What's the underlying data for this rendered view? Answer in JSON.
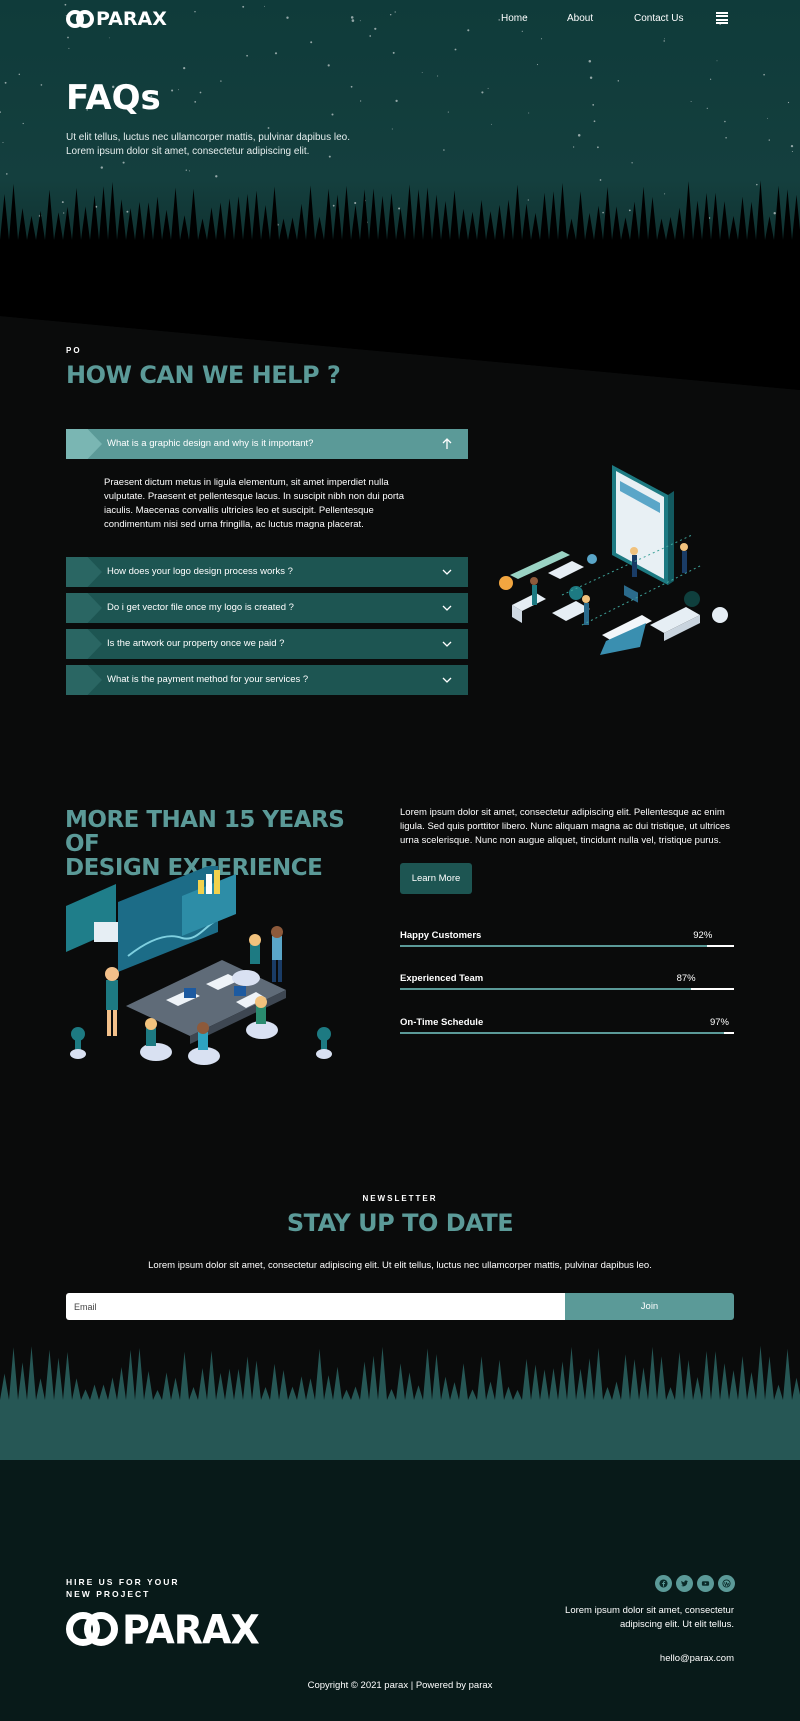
{
  "nav": {
    "logo_text": "PARAX",
    "links": [
      "Home",
      "About",
      "Contact Us"
    ]
  },
  "hero": {
    "title": "FAQs",
    "subtitle_line1": "Ut elit tellus, luctus nec ullamcorper mattis, pulvinar dapibus leo.",
    "subtitle_line2": "Lorem ipsum dolor sit amet, consectetur adipiscing elit."
  },
  "faq": {
    "eyebrow": "PO",
    "title": "HOW CAN WE HELP ?",
    "items": [
      {
        "question": "What is a graphic design and why is it important?",
        "expanded": true
      },
      {
        "question": "How does your logo design process works ?",
        "expanded": false
      },
      {
        "question": "Do i get vector file once my logo is created ?",
        "expanded": false
      },
      {
        "question": "Is the artwork our property once we paid ?",
        "expanded": false
      },
      {
        "question": "What is the payment method for your services ?",
        "expanded": false
      }
    ],
    "answer": "Praesent dictum metus in ligula elementum, sit amet imperdiet nulla vulputate. Praesent et pellentesque lacus. In suscipit nibh non dui porta iaculis. Maecenas convallis ultricies leo et suscipit. Pellentesque condimentum nisi sed urna fringilla, ac luctus magna placerat."
  },
  "experience": {
    "title_line1": "MORE THAN 15 YEARS OF",
    "title_line2": "DESIGN EXPERIENCE",
    "text": "Lorem ipsum dolor sit amet, consectetur adipiscing elit. Pellentesque ac enim ligula. Sed quis porttitor libero. Nunc aliquam magna ac dui tristique, ut ultrices urna scelerisque. Nunc non augue aliquet, tincidunt nulla vel, tristique purus.",
    "button_label": "Learn More",
    "skills": [
      {
        "name": "Happy Customers",
        "percent_label": "92%",
        "value": 92
      },
      {
        "name": "Experienced Team",
        "percent_label": "87%",
        "value": 87
      },
      {
        "name": "On-Time Schedule",
        "percent_label": "97%",
        "value": 97
      }
    ]
  },
  "newsletter": {
    "eyebrow": "NEWSLETTER",
    "title": "STAY UP TO DATE",
    "text": "Lorem ipsum dolor sit amet, consectetur adipiscing elit. Ut elit tellus, luctus nec ullamcorper mattis, pulvinar dapibus leo.",
    "email_placeholder": "Email",
    "join_label": "Join"
  },
  "footer": {
    "hire_line1": "HIRE US FOR YOUR",
    "hire_line2": "NEW PROJECT",
    "logo_text": "PARAX",
    "social_icons": [
      "facebook-icon",
      "twitter-icon",
      "youtube-icon",
      "wordpress-icon"
    ],
    "text": "Lorem ipsum dolor sit amet, consectetur adipiscing elit. Ut elit tellus.",
    "email": "hello@parax.com",
    "copyright": "Copyright © 2021 parax | Powered by parax"
  },
  "colors": {
    "accent": "#5b9a98",
    "dark_teal": "#1d5552",
    "hero_bg": "#0f3b3a",
    "page_bg": "#0a0b0b"
  }
}
